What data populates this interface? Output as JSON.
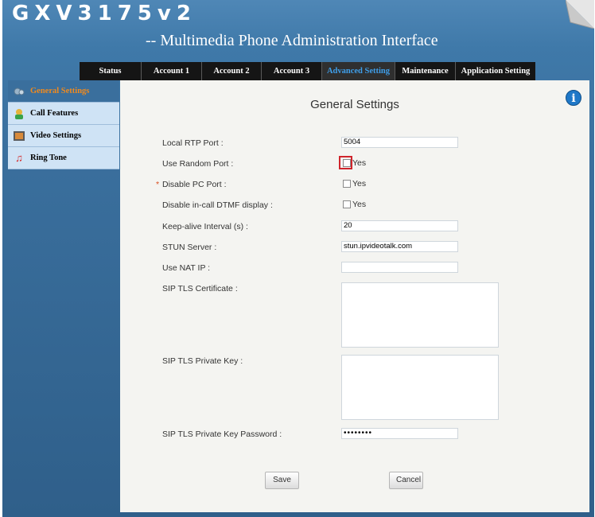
{
  "header": {
    "brand": "GXV3175v2",
    "subtitle": "-- Multimedia Phone Administration Interface"
  },
  "nav": {
    "tabs": [
      {
        "label": "Status"
      },
      {
        "label": "Account 1"
      },
      {
        "label": "Account 2"
      },
      {
        "label": "Account 3"
      },
      {
        "label": "Advanced Setting",
        "active": true
      },
      {
        "label": "Maintenance"
      },
      {
        "label": "Application Setting"
      }
    ]
  },
  "sidebar": {
    "items": [
      {
        "label": "General Settings",
        "icon": "gears-icon",
        "active": true
      },
      {
        "label": "Call Features",
        "icon": "call-features-icon"
      },
      {
        "label": "Video Settings",
        "icon": "video-icon"
      },
      {
        "label": "Ring Tone",
        "icon": "music-note-icon"
      }
    ]
  },
  "main": {
    "title": "General Settings",
    "local_rtp_port": {
      "label": "Local RTP Port :",
      "value": "5004"
    },
    "use_random_port": {
      "label": "Use Random Port :",
      "option": "Yes",
      "checked": false
    },
    "disable_pc_port": {
      "label": "Disable PC Port :",
      "required_mark": "*",
      "option": "Yes",
      "checked": false
    },
    "disable_dtmf": {
      "label": "Disable in-call DTMF display :",
      "option": "Yes",
      "checked": false
    },
    "keep_alive": {
      "label": "Keep-alive Interval (s) :",
      "value": "20"
    },
    "stun_server": {
      "label": "STUN Server :",
      "value": "stun.ipvideotalk.com"
    },
    "use_nat_ip": {
      "label": "Use NAT IP :",
      "value": ""
    },
    "sip_tls_cert": {
      "label": "SIP TLS Certificate :"
    },
    "sip_tls_key": {
      "label": "SIP TLS Private Key :"
    },
    "sip_tls_key_password": {
      "label": "SIP TLS Private Key Password :",
      "value": "••••••••"
    },
    "save_label": "Save",
    "cancel_label": "Cancel"
  },
  "colors": {
    "active_tab": "#3f9fea",
    "active_sidebar": "#f08a1e",
    "highlight": "#d0252c"
  }
}
